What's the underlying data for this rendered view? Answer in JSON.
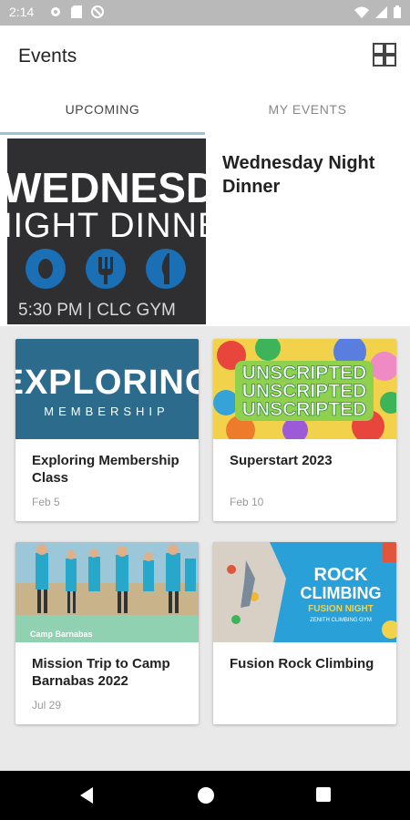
{
  "status_bar": {
    "time": "2:14"
  },
  "app_bar": {
    "title": "Events"
  },
  "tabs": [
    {
      "label": "UPCOMING",
      "active": true
    },
    {
      "label": "MY EVENTS",
      "active": false
    }
  ],
  "featured": {
    "title": "Wednesday Night Dinner",
    "image": {
      "line1": "WEDNESDAY",
      "line2": "NIGHT DINNER",
      "footer": "5:30 PM  |  CLC GYM"
    }
  },
  "events": [
    {
      "title": "Exploring Membership Class",
      "date": "Feb 5",
      "image": {
        "line1": "EXPLORING",
        "line2": "MEMBERSHIP"
      }
    },
    {
      "title": "Superstart 2023",
      "date": "Feb 10",
      "image": {
        "line1": "UNSCRIPTED"
      }
    },
    {
      "title": "Mission Trip to Camp Barnabas 2022",
      "date": "Jul 29",
      "image": {
        "logo": "Camp Barnabas"
      }
    },
    {
      "title": "Fusion Rock Climbing",
      "date": "",
      "image": {
        "line1": "ROCK",
        "line2": "CLIMBING",
        "line3": "FUSION NIGHT",
        "line4": "ZENITH CLIMBING GYM"
      }
    }
  ],
  "colors": {
    "accent": "#9ec2d0",
    "statusbar": "#b9b9b9",
    "membership_blue": "#2c6b8b",
    "rock_blue": "#2aa0d8"
  }
}
